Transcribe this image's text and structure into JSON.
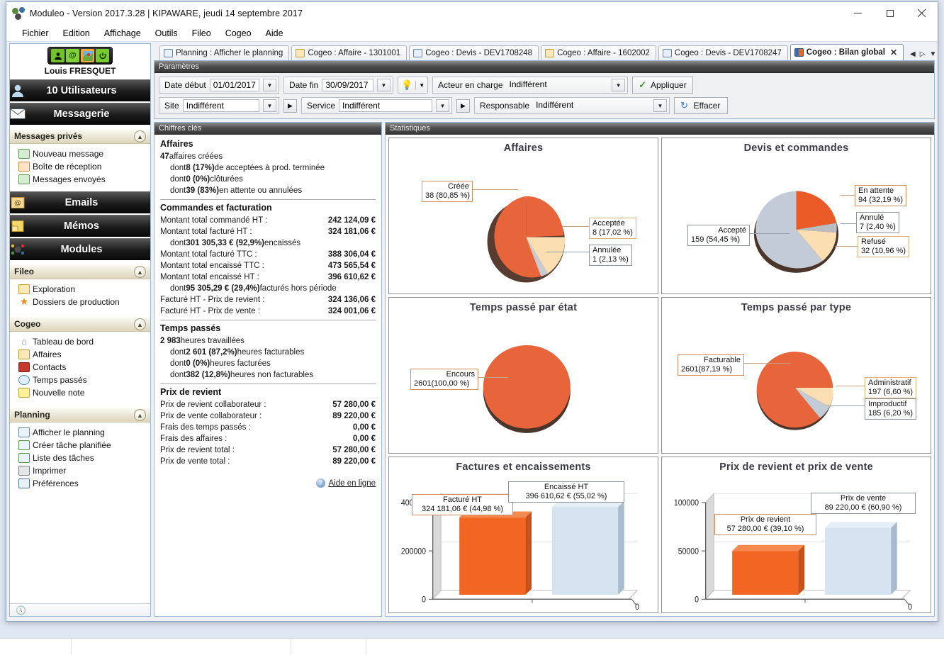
{
  "window": {
    "title": "Moduleo - Version 2017.3.28 | KIPAWARE, jeudi 14 septembre 2017",
    "minimize": "–",
    "maximize": "□",
    "close": "✕"
  },
  "menubar": {
    "items": [
      "Fichier",
      "Edition",
      "Affichage",
      "Outils",
      "Fileo",
      "Cogeo",
      "Aide"
    ]
  },
  "sidebar": {
    "user_name": "Louis FRESQUET",
    "quick_icons": [
      "user-icon",
      "email-icon",
      "map-icon",
      "power-icon"
    ],
    "bars": [
      {
        "label": "10 Utilisateurs",
        "icon": "users-icon"
      },
      {
        "label": "Messagerie",
        "icon": "envelope-icon"
      },
      {
        "label": "Emails",
        "icon": "at-icon"
      },
      {
        "label": "Mémos",
        "icon": "note-icon"
      },
      {
        "label": "Modules",
        "icon": "modules-icon"
      }
    ],
    "sections": [
      {
        "title": "Messages privés",
        "items": [
          {
            "label": "Nouveau message",
            "icon": "new-message-icon"
          },
          {
            "label": "Boîte de réception",
            "icon": "inbox-icon"
          },
          {
            "label": "Messages envoyés",
            "icon": "sent-icon"
          }
        ]
      },
      {
        "title": "Fileo",
        "items": [
          {
            "label": "Exploration",
            "icon": "folder-explore-icon"
          },
          {
            "label": "Dossiers de production",
            "icon": "star-icon"
          }
        ]
      },
      {
        "title": "Cogeo",
        "items": [
          {
            "label": "Tableau de bord",
            "icon": "home-icon"
          },
          {
            "label": "Affaires",
            "icon": "folder-icon"
          },
          {
            "label": "Contacts",
            "icon": "contacts-icon"
          },
          {
            "label": "Temps passés",
            "icon": "clock-icon"
          },
          {
            "label": "Nouvelle note",
            "icon": "new-note-icon"
          }
        ]
      },
      {
        "title": "Planning",
        "items": [
          {
            "label": "Afficher le planning",
            "icon": "calendar-icon"
          },
          {
            "label": "Créer tâche planifiée",
            "icon": "calendar-add-icon"
          },
          {
            "label": "Liste des tâches",
            "icon": "task-list-icon"
          },
          {
            "label": "Imprimer",
            "icon": "printer-icon"
          },
          {
            "label": "Préférences",
            "icon": "preferences-icon"
          }
        ]
      }
    ]
  },
  "tabs": [
    {
      "label": "Planning : Afficher le planning",
      "icon": "calendar-icon",
      "active": false
    },
    {
      "label": "Cogeo : Affaire - 1301001",
      "icon": "folder-icon",
      "active": false
    },
    {
      "label": "Cogeo : Devis - DEV1708248",
      "icon": "devis-icon",
      "active": false
    },
    {
      "label": "Cogeo : Affaire - 1602002",
      "icon": "folder-icon",
      "active": false
    },
    {
      "label": "Cogeo : Devis - DEV1708247",
      "icon": "devis-icon",
      "active": false
    },
    {
      "label": "Cogeo : Bilan global",
      "icon": "chart-icon",
      "active": true,
      "close": "✕"
    }
  ],
  "tabnav": {
    "prev": "◀",
    "next": "▷",
    "list": "▼"
  },
  "params": {
    "header": "Paramètres",
    "date_debut_label": "Date début",
    "date_debut_value": "01/01/2017",
    "date_fin_label": "Date fin",
    "date_fin_value": "30/09/2017",
    "bulb_icon": "lightbulb-icon",
    "acteur_label": "Acteur en charge",
    "acteur_value": "Indifférent",
    "site_label": "Site",
    "site_value": "Indifférent",
    "service_label": "Service",
    "service_value": "Indifférent",
    "responsable_label": "Responsable",
    "responsable_value": "Indifférent",
    "apply_label": "Appliquer",
    "clear_label": "Effacer",
    "dropdown_glyph": "▼",
    "go_glyph": "▶"
  },
  "kpi": {
    "header": "Chiffres clés",
    "help_link": "Aide en ligne",
    "groups": [
      {
        "title": "Affaires",
        "lines": [
          {
            "type": "text",
            "html": "<b>47</b> affaires créées",
            "indent": 0
          },
          {
            "type": "text",
            "html": "dont <b>8 (17%)</b> de  acceptées à prod. terminée",
            "indent": 1
          },
          {
            "type": "text",
            "html": "dont <b>0 (0%)</b> clôturées",
            "indent": 1
          },
          {
            "type": "text",
            "html": "dont <b>39 (83%)</b> en attente ou annulées",
            "indent": 1
          }
        ]
      },
      {
        "title": "Commandes et facturation",
        "lines": [
          {
            "type": "kv",
            "label": "Montant total commandé HT :",
            "value": "242 124,09 €"
          },
          {
            "type": "kv",
            "label": "Montant total facturé HT :",
            "value": "324 181,06 €"
          },
          {
            "type": "text",
            "html": "dont <b>301 305,33 € (92,9%)</b> encaissés",
            "indent": 1
          },
          {
            "type": "kv",
            "label": "Montant total facturé TTC :",
            "value": "388 306,04 €"
          },
          {
            "type": "kv",
            "label": "Montant total encaissé TTC :",
            "value": "473 565,54 €"
          },
          {
            "type": "kv",
            "label": "Montant total encaissé HT :",
            "value": "396 610,62 €"
          },
          {
            "type": "text",
            "html": "dont <b>95 305,29 € (29,4%)</b> facturés hors période",
            "indent": 1
          },
          {
            "type": "kv",
            "label": "Facturé HT - Prix de revient :",
            "value": "324 136,06 €"
          },
          {
            "type": "kv",
            "label": "Facturé HT - Prix de vente :",
            "value": "324 001,06 €"
          }
        ]
      },
      {
        "title": "Temps passés",
        "lines": [
          {
            "type": "text",
            "html": "<b>2 983</b> heures travaillées",
            "indent": 0
          },
          {
            "type": "text",
            "html": "dont <b>2 601 (87,2%)</b> heures facturables",
            "indent": 1
          },
          {
            "type": "text",
            "html": "dont <b>0 (0%)</b> heures facturées",
            "indent": 1
          },
          {
            "type": "text",
            "html": "dont <b>382 (12,8%)</b> heures non facturables",
            "indent": 1
          }
        ]
      },
      {
        "title": "Prix de revient",
        "lines": [
          {
            "type": "kv",
            "label": "Prix de revient collaborateur :",
            "value": "57 280,00 €"
          },
          {
            "type": "kv",
            "label": "Prix de vente collaborateur :",
            "value": "89 220,00 €"
          },
          {
            "type": "kv",
            "label": "Frais des temps passés :",
            "value": "0,00 €"
          },
          {
            "type": "kv",
            "label": "Frais des affaires :",
            "value": "0,00 €"
          },
          {
            "type": "kv",
            "label": "Prix de revient total :",
            "value": "57 280,00 €"
          },
          {
            "type": "kv",
            "label": "Prix de vente total :",
            "value": "89 220,00 €"
          }
        ]
      }
    ]
  },
  "stats": {
    "header": "Statistiques"
  },
  "chart_data": [
    {
      "type": "pie",
      "title": "Affaires",
      "labels": [
        "Créée",
        "Acceptée",
        "Annulée"
      ],
      "values": [
        38,
        8,
        1
      ],
      "percents": [
        80.85,
        17.02,
        2.13
      ],
      "colors": [
        "#e8643a",
        "#fbdfb2",
        "#c8ccd1"
      ],
      "callouts": [
        {
          "l1": "Créée",
          "l2": "38 (80,85 %)"
        },
        {
          "l1": "Acceptée",
          "l2": "8 (17,02 %)"
        },
        {
          "l1": "Annulée",
          "l2": "1 (2,13 %)"
        }
      ]
    },
    {
      "type": "pie",
      "title": "Devis et commandes",
      "labels": [
        "En attente",
        "Annulé",
        "Refusé",
        "Accepté"
      ],
      "values": [
        94,
        7,
        32,
        159
      ],
      "percents": [
        32.19,
        2.4,
        10.96,
        54.45
      ],
      "colors": [
        "#ea5b28",
        "#b9bdc3",
        "#fbdfb2",
        "#c3ccd6"
      ],
      "callouts": [
        {
          "l1": "En attente",
          "l2": "94 (32,19 %)"
        },
        {
          "l1": "Annulé",
          "l2": "7 (2,40 %)"
        },
        {
          "l1": "Refusé",
          "l2": "32 (10,96 %)"
        },
        {
          "l1": "Accepté",
          "l2": "159 (54,45 %)"
        }
      ]
    },
    {
      "type": "pie",
      "title": "Temps passé par état",
      "labels": [
        "Encours"
      ],
      "values": [
        2601
      ],
      "percents": [
        100.0
      ],
      "colors": [
        "#e8643a"
      ],
      "callouts": [
        {
          "l1": "Encours",
          "l2": "2601(100,00 %)"
        }
      ]
    },
    {
      "type": "pie",
      "title": "Temps passé par type",
      "labels": [
        "Facturable",
        "Administratif",
        "Improductif"
      ],
      "values": [
        2601,
        197,
        185
      ],
      "percents": [
        87.19,
        6.6,
        6.2
      ],
      "colors": [
        "#e8643a",
        "#fbdfb2",
        "#c3ccd6"
      ],
      "callouts": [
        {
          "l1": "Facturable",
          "l2": "2601(87,19 %)"
        },
        {
          "l1": "Administratif",
          "l2": "197 (6,60 %)"
        },
        {
          "l1": "Improductif",
          "l2": "185 (6,20 %)"
        }
      ]
    },
    {
      "type": "bar",
      "title": "Factures et encaissements",
      "categories": [
        "Facturé HT",
        "Encaissé HT"
      ],
      "values": [
        324181.06,
        396610.62
      ],
      "percents": [
        44.98,
        55.02
      ],
      "yticks": [
        "400000",
        "200000",
        "0"
      ],
      "ylim": [
        0,
        450000
      ],
      "xaxis_label": "0",
      "colors": [
        "#f26522",
        "#d5e4f0"
      ],
      "callouts": [
        {
          "l1": "Facturé HT",
          "l2": "324 181,06 € (44,98 %)"
        },
        {
          "l1": "Encaissé HT",
          "l2": "396 610,62 € (55,02 %)"
        }
      ]
    },
    {
      "type": "bar",
      "title": "Prix de revient et prix de vente",
      "categories": [
        "Prix de revient",
        "Prix de vente"
      ],
      "values": [
        57280.0,
        89220.0
      ],
      "percents": [
        39.1,
        60.9
      ],
      "yticks": [
        "100000",
        "50000",
        "0"
      ],
      "ylim": [
        0,
        112000
      ],
      "xaxis_label": "0",
      "colors": [
        "#f26522",
        "#d5e4f0"
      ],
      "callouts": [
        {
          "l1": "Prix de revient",
          "l2": "57 280,00 € (39,10 %)"
        },
        {
          "l1": "Prix de vente",
          "l2": "89 220,00 € (60,90 %)"
        }
      ]
    }
  ],
  "statusbar": {
    "icon": "clock-icon"
  }
}
